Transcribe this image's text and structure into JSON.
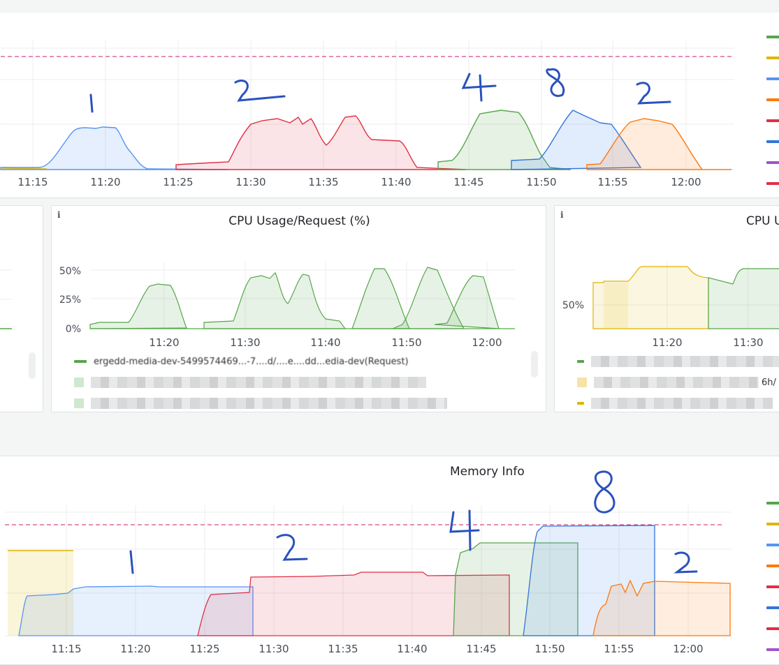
{
  "panels": {
    "cpu_request": {
      "title": "CPU Usage/Request (%)",
      "info": "i"
    },
    "cpu_right": {
      "title": "CPU U",
      "info": "i"
    },
    "memory": {
      "title": "Memory Info"
    }
  },
  "top_chart": {
    "x_ticks": [
      "11:15",
      "11:20",
      "11:25",
      "11:30",
      "11:35",
      "11:40",
      "11:45",
      "11:50",
      "11:55",
      "12:00"
    ],
    "annotations": [
      "1",
      "2",
      "4",
      "8",
      "2"
    ]
  },
  "cpu_request_chart": {
    "y_ticks": [
      "50%",
      "25%",
      "0%"
    ],
    "x_ticks": [
      "11:20",
      "11:30",
      "11:40",
      "11:50",
      "12:00"
    ],
    "legend": [
      "ergedd-media-dev-5499574469...-7....d/....e....dd...edia-dev(Request)"
    ]
  },
  "cpu_right_chart": {
    "y_ticks": [
      "50%"
    ],
    "x_ticks": [
      "11:20",
      "11:30"
    ],
    "legend_fragment": "6h/"
  },
  "memory_chart": {
    "x_ticks": [
      "11:15",
      "11:20",
      "11:25",
      "11:30",
      "11:35",
      "11:40",
      "11:45",
      "11:50",
      "11:55",
      "12:00"
    ],
    "annotations": [
      "1",
      "2",
      "4",
      "8",
      "2"
    ]
  },
  "colors": {
    "green": "#56a64b",
    "yellow": "#e0b400",
    "blue": "#5794f2",
    "orange": "#ff780a",
    "red": "#e02f44",
    "dark_blue": "#3274d9",
    "purple": "#a352cc",
    "threshold": "#d44a8a",
    "ink": "#2a52be"
  },
  "right_legend_colors": [
    "green",
    "yellow",
    "blue",
    "orange",
    "red",
    "dark_blue",
    "purple",
    "red"
  ]
}
